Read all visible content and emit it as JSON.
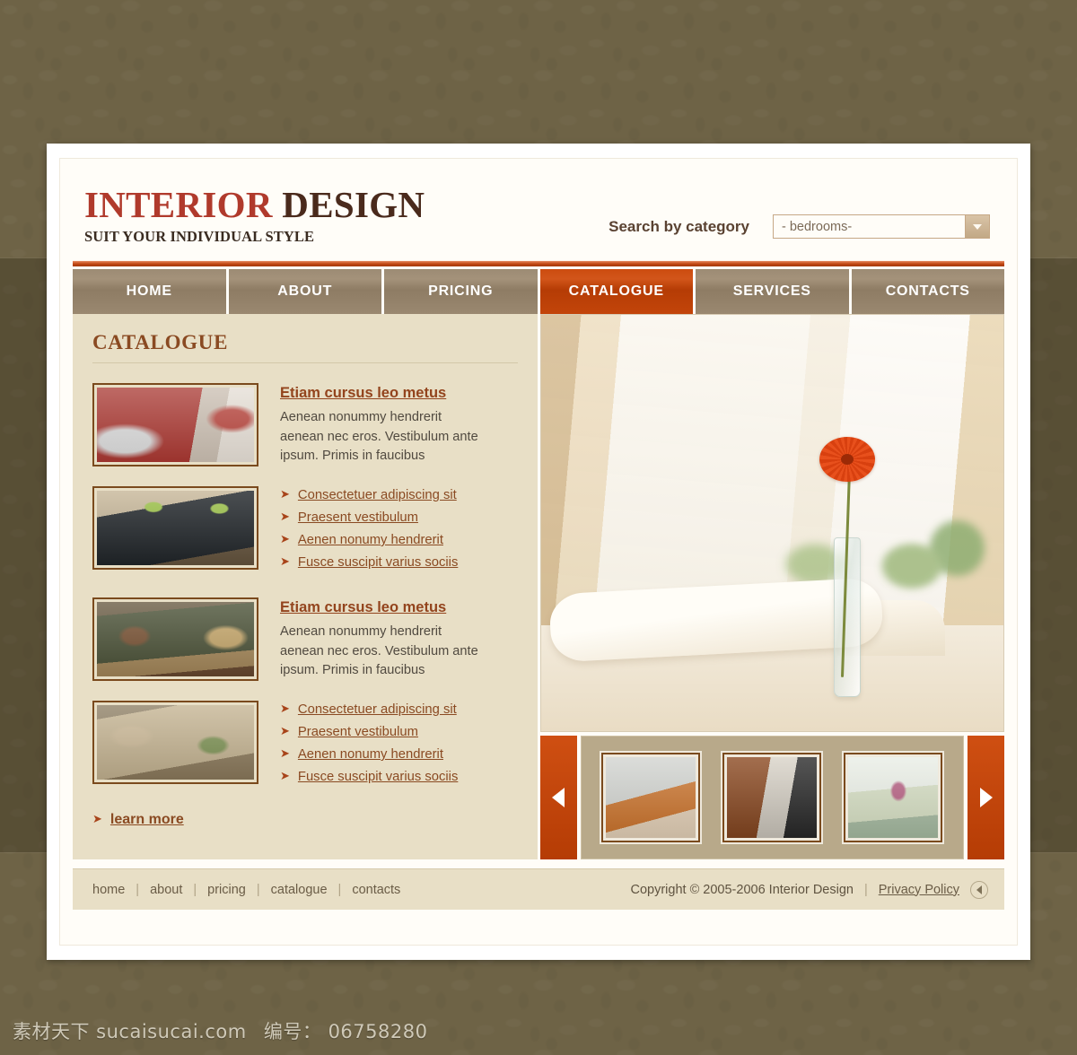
{
  "site": {
    "logo_main": "INTERIOR",
    "logo_accent": "DESIGN",
    "tagline": "SUIT YOUR INDIVIDUAL STYLE"
  },
  "search": {
    "label": "Search by category",
    "selected": "- bedrooms-",
    "arrow_icon": "chevron-down-icon"
  },
  "nav": {
    "items": [
      {
        "label": "HOME",
        "active": false
      },
      {
        "label": "ABOUT",
        "active": false
      },
      {
        "label": "PRICING",
        "active": false
      },
      {
        "label": "CATALOGUE",
        "active": true
      },
      {
        "label": "SERVICES",
        "active": false
      },
      {
        "label": "CONTACTS",
        "active": false
      }
    ]
  },
  "catalogue": {
    "heading": "CATALOGUE",
    "entries": [
      {
        "type": "article",
        "thumb_alt": "red-leather-sectional-sofa",
        "title": "Etiam cursus leo metus",
        "body": "Aenean nonummy hendrerit aenean nec eros. Vestibulum ante ipsum. Primis in faucibus"
      },
      {
        "type": "links",
        "thumb_alt": "dark-dining-table-with-green-napkins",
        "links": [
          "Consectetuer adipiscing sit",
          "Praesent vestibulum",
          "Aenen nonumy hendrerit",
          "Fusce suscipit varius sociis"
        ]
      },
      {
        "type": "article",
        "thumb_alt": "olive-green-leather-sofa",
        "title": "Etiam cursus leo metus",
        "body": "Aenean nonummy hendrerit aenean nec eros. Vestibulum ante ipsum. Primis in faucibus"
      },
      {
        "type": "links",
        "thumb_alt": "beige-patterned-fabric-sofa-set",
        "links": [
          "Consectetuer adipiscing sit",
          "Praesent vestibulum",
          "Aenen nonumy hendrerit",
          "Fusce suscipit varius sociis"
        ]
      }
    ],
    "learn_more": "learn more",
    "bullet_icon": "arrow-right-icon"
  },
  "hero": {
    "alt": "cream-bedroom-window-with-orange-gerbera-in-glass-vase"
  },
  "carousel": {
    "prev_icon": "arrow-left-icon",
    "next_icon": "arrow-right-icon",
    "thumbs": [
      {
        "alt": "modern-kitchen-with-orange-island"
      },
      {
        "alt": "lounge-with-wood-panel-wall"
      },
      {
        "alt": "green-dining-room-with-gold-chairs"
      }
    ]
  },
  "footer": {
    "links": [
      "home",
      "about",
      "pricing",
      "catalogue",
      "contacts"
    ],
    "separator": "|",
    "copyright": "Copyright © 2005-2006 Interior Design",
    "privacy": "Privacy Policy",
    "icon": "play-back-icon"
  },
  "watermark": {
    "site": "素材天下 sucaisucai.com",
    "number": "编号： 06758280"
  },
  "colors": {
    "accent_orange": "#c0460f",
    "logo_red": "#b03a2c",
    "logo_brown": "#4a2a1c",
    "nav_brown": "#9a8870",
    "panel_cream": "#e8dfc6",
    "desktop_brown": "#6e6346"
  }
}
